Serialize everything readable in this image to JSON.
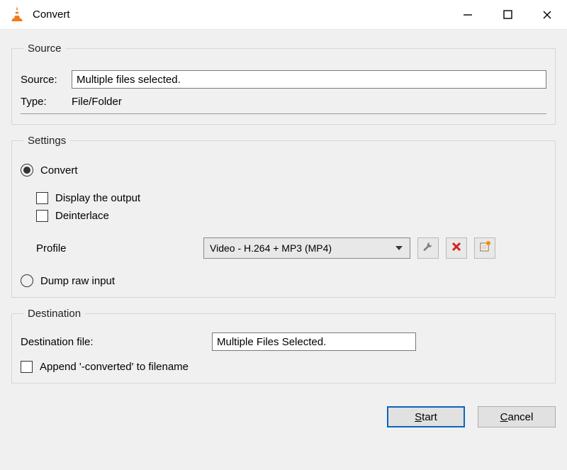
{
  "window": {
    "title": "Convert"
  },
  "source": {
    "legend": "Source",
    "source_label": "Source:",
    "source_value": "Multiple files selected.",
    "type_label": "Type:",
    "type_value": "File/Folder"
  },
  "settings": {
    "legend": "Settings",
    "convert_label": "Convert",
    "convert_selected": true,
    "display_output_label": "Display the output",
    "display_output_checked": false,
    "deinterlace_label": "Deinterlace",
    "deinterlace_checked": false,
    "profile_label": "Profile",
    "profile_selected": "Video - H.264 + MP3 (MP4)",
    "dump_label": "Dump raw input",
    "dump_selected": false,
    "icon_edit": "wrench-icon",
    "icon_delete": "delete-x-icon",
    "icon_new": "new-profile-icon"
  },
  "destination": {
    "legend": "Destination",
    "file_label": "Destination file:",
    "file_value": "Multiple Files Selected.",
    "append_label": "Append '-converted' to filename",
    "append_checked": false
  },
  "footer": {
    "start_label": "Start",
    "cancel_label": "Cancel"
  }
}
